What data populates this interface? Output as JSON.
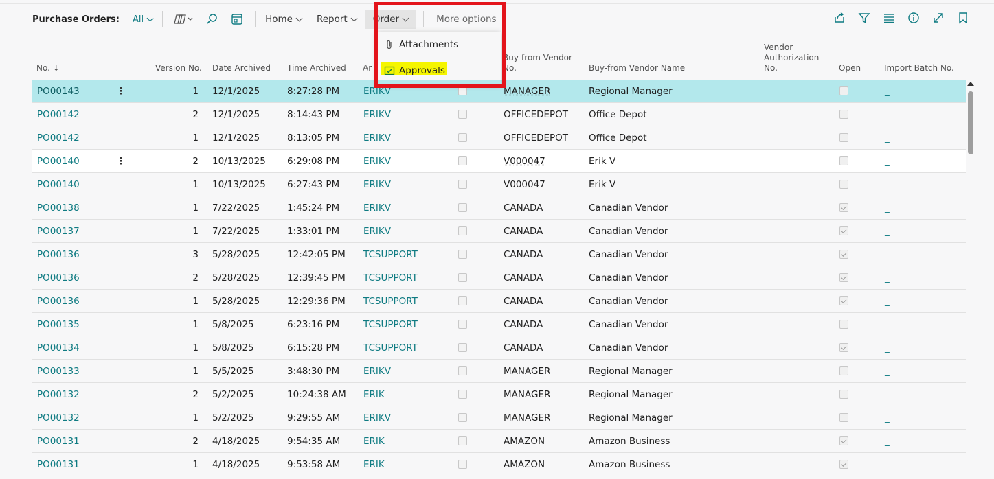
{
  "toolbar": {
    "title": "Purchase Orders:",
    "filter": "All",
    "menus": {
      "home": "Home",
      "report": "Report",
      "order": "Order"
    },
    "more": "More options"
  },
  "icons": {
    "copilot": "copilot-icon",
    "search": "search-icon",
    "edit_list": "edit-list-icon",
    "share": "share-icon",
    "filter": "filter-icon",
    "list_view": "list-view-icon",
    "info": "info-icon",
    "expand": "expand-icon",
    "bookmark": "bookmark-icon",
    "attachment": "paperclip-icon",
    "approvals": "approvals-icon"
  },
  "dropdown": {
    "items": [
      "Attachments",
      "Approvals"
    ]
  },
  "columns": {
    "no": "No. ↓",
    "version": "Version No.",
    "date": "Date Archived",
    "time": "Time Archived",
    "archived_by": "Ar",
    "vendor_no_1": "Buy-from Vendor",
    "vendor_no_2": "No.",
    "vendor_name": "Buy-from Vendor Name",
    "auth_1": "Vendor",
    "auth_2": "Authorization",
    "auth_3": "No.",
    "open": "Open",
    "import": "Import Batch No."
  },
  "rows": [
    {
      "no": "PO00143",
      "ver": "1",
      "date": "12/1/2025",
      "time": "8:27:28 PM",
      "user": "ERIKV",
      "vend": "MANAGER",
      "name": "Regional Manager",
      "open": false,
      "imp": "_"
    },
    {
      "no": "PO00142",
      "ver": "2",
      "date": "12/1/2025",
      "time": "8:14:43 PM",
      "user": "ERIKV",
      "vend": "OFFICEDEPOT",
      "name": "Office Depot",
      "open": false,
      "imp": "_"
    },
    {
      "no": "PO00142",
      "ver": "1",
      "date": "12/1/2025",
      "time": "8:13:05 PM",
      "user": "ERIKV",
      "vend": "OFFICEDEPOT",
      "name": "Office Depot",
      "open": false,
      "imp": "_"
    },
    {
      "no": "PO00140",
      "ver": "2",
      "date": "10/13/2025",
      "time": "6:29:08 PM",
      "user": "ERIKV",
      "vend": "V000047",
      "name": "Erik V",
      "open": false,
      "imp": "_"
    },
    {
      "no": "PO00140",
      "ver": "1",
      "date": "10/13/2025",
      "time": "6:27:43 PM",
      "user": "ERIKV",
      "vend": "V000047",
      "name": "Erik V",
      "open": false,
      "imp": "_"
    },
    {
      "no": "PO00138",
      "ver": "1",
      "date": "7/22/2025",
      "time": "1:45:24 PM",
      "user": "ERIKV",
      "vend": "CANADA",
      "name": "Canadian Vendor",
      "open": true,
      "imp": "_"
    },
    {
      "no": "PO00137",
      "ver": "1",
      "date": "7/22/2025",
      "time": "1:33:01 PM",
      "user": "ERIKV",
      "vend": "CANADA",
      "name": "Canadian Vendor",
      "open": true,
      "imp": "_"
    },
    {
      "no": "PO00136",
      "ver": "3",
      "date": "5/28/2025",
      "time": "12:42:05 PM",
      "user": "TCSUPPORT",
      "vend": "CANADA",
      "name": "Canadian Vendor",
      "open": true,
      "imp": "_"
    },
    {
      "no": "PO00136",
      "ver": "2",
      "date": "5/28/2025",
      "time": "12:39:45 PM",
      "user": "TCSUPPORT",
      "vend": "CANADA",
      "name": "Canadian Vendor",
      "open": true,
      "imp": "_"
    },
    {
      "no": "PO00136",
      "ver": "1",
      "date": "5/28/2025",
      "time": "12:29:36 PM",
      "user": "TCSUPPORT",
      "vend": "CANADA",
      "name": "Canadian Vendor",
      "open": true,
      "imp": "_"
    },
    {
      "no": "PO00135",
      "ver": "1",
      "date": "5/8/2025",
      "time": "6:23:16 PM",
      "user": "TCSUPPORT",
      "vend": "CANADA",
      "name": "Canadian Vendor",
      "open": false,
      "imp": "_"
    },
    {
      "no": "PO00134",
      "ver": "1",
      "date": "5/8/2025",
      "time": "6:15:28 PM",
      "user": "TCSUPPORT",
      "vend": "CANADA",
      "name": "Canadian Vendor",
      "open": true,
      "imp": "_"
    },
    {
      "no": "PO00133",
      "ver": "1",
      "date": "5/5/2025",
      "time": "3:48:30 PM",
      "user": "ERIKV",
      "vend": "MANAGER",
      "name": "Regional Manager",
      "open": false,
      "imp": "_"
    },
    {
      "no": "PO00132",
      "ver": "2",
      "date": "5/2/2025",
      "time": "10:24:38 AM",
      "user": "ERIK",
      "vend": "MANAGER",
      "name": "Regional Manager",
      "open": false,
      "imp": "_"
    },
    {
      "no": "PO00132",
      "ver": "1",
      "date": "5/2/2025",
      "time": "9:29:55 AM",
      "user": "ERIKV",
      "vend": "MANAGER",
      "name": "Regional Manager",
      "open": false,
      "imp": "_"
    },
    {
      "no": "PO00131",
      "ver": "2",
      "date": "4/18/2025",
      "time": "9:54:35 AM",
      "user": "ERIK",
      "vend": "AMAZON",
      "name": "Amazon Business",
      "open": true,
      "imp": "_"
    },
    {
      "no": "PO00131",
      "ver": "1",
      "date": "4/18/2025",
      "time": "9:53:58 AM",
      "user": "ERIK",
      "vend": "AMAZON",
      "name": "Amazon Business",
      "open": true,
      "imp": "_"
    }
  ],
  "colors": {
    "accent": "#0f7b82",
    "selected_row": "#b3e8ec",
    "annotation_red": "#e3141b",
    "highlight_yellow": "#f5f500"
  }
}
